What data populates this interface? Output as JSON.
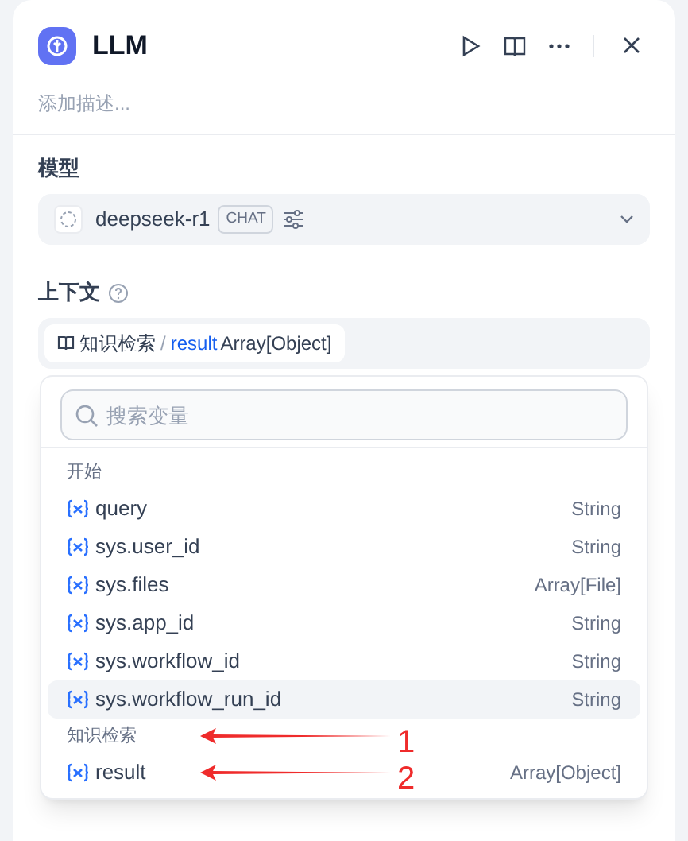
{
  "panel": {
    "title": "LLM",
    "description_placeholder": "添加描述..."
  },
  "model": {
    "label": "模型",
    "name": "deepseek-r1",
    "badge": "CHAT"
  },
  "context": {
    "label": "上下文",
    "source": "知识检索",
    "separator": "/",
    "variable": "result",
    "type": "Array[Object]"
  },
  "dropdown": {
    "search_placeholder": "搜索变量",
    "groups": [
      {
        "title": "开始",
        "items": [
          {
            "name": "query",
            "type": "String",
            "selected": false
          },
          {
            "name": "sys.user_id",
            "type": "String",
            "selected": false
          },
          {
            "name": "sys.files",
            "type": "Array[File]",
            "selected": false
          },
          {
            "name": "sys.app_id",
            "type": "String",
            "selected": false
          },
          {
            "name": "sys.workflow_id",
            "type": "String",
            "selected": false
          },
          {
            "name": "sys.workflow_run_id",
            "type": "String",
            "selected": true
          }
        ]
      },
      {
        "title": "知识检索",
        "items": [
          {
            "name": "result",
            "type": "Array[Object]",
            "selected": false
          }
        ]
      }
    ]
  },
  "annotations": [
    "1",
    "2"
  ]
}
